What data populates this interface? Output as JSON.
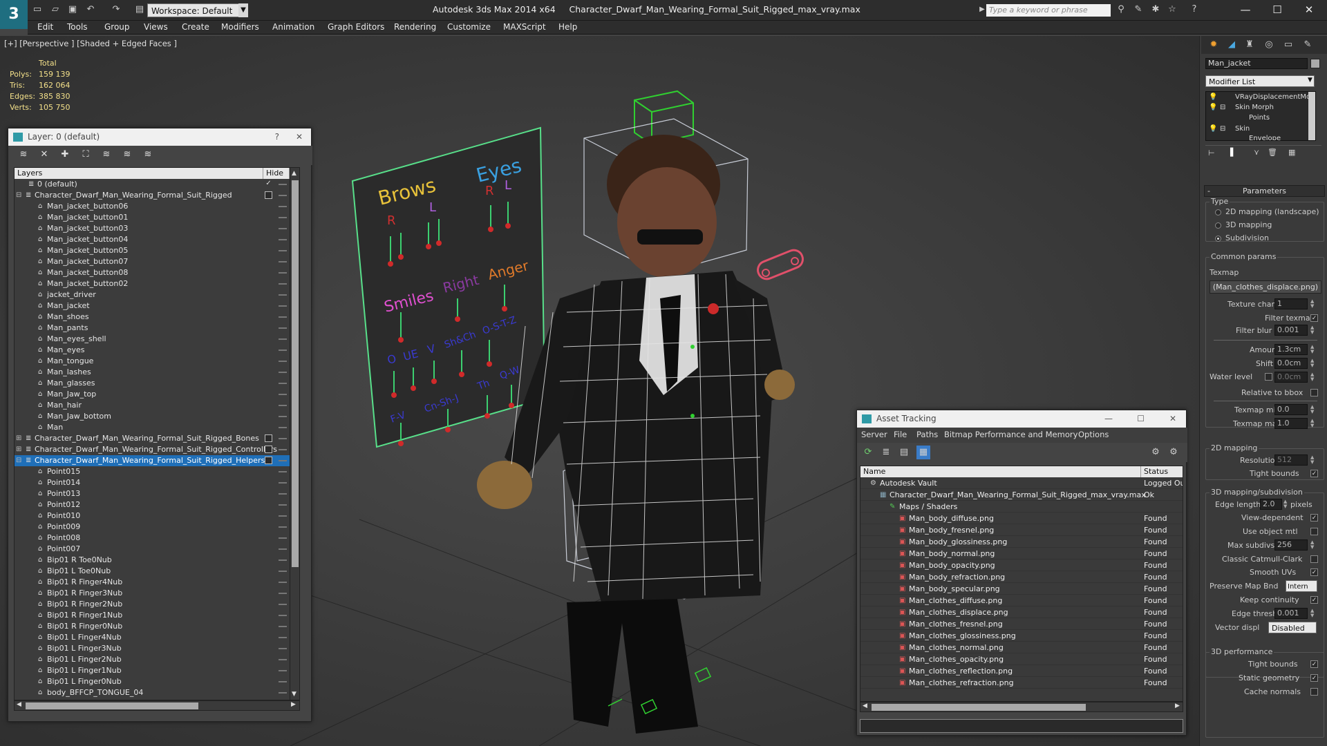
{
  "app": {
    "title": "Autodesk 3ds Max  2014 x64",
    "filename": "Character_Dwarf_Man_Wearing_Formal_Suit_Rigged_max_vray.max",
    "workspace": "Workspace: Default",
    "search_placeholder": "Type a keyword or phrase"
  },
  "menu": [
    "Edit",
    "Tools",
    "Group",
    "Views",
    "Create",
    "Modifiers",
    "Animation",
    "Graph Editors",
    "Rendering",
    "Customize",
    "MAXScript",
    "Help"
  ],
  "viewport": {
    "label": "[+] [Perspective ] [Shaded + Edged Faces ]",
    "stats_header": "Total",
    "stats": [
      {
        "k": "Polys:",
        "v": "159 139"
      },
      {
        "k": "Tris:",
        "v": "162 064"
      },
      {
        "k": "Edges:",
        "v": "385 830"
      },
      {
        "k": "Verts:",
        "v": "105 750"
      }
    ],
    "board_labels": [
      "Brows",
      "Eyes",
      "L",
      "R",
      "R",
      "L",
      "Smiles",
      "Right",
      "Anger",
      "O",
      "UE",
      "V",
      "Sh&Ch",
      "O-S-T-Z",
      "F-V",
      "Cn-Sh-J",
      "Th",
      "Q-W"
    ]
  },
  "layer_dialog": {
    "title": "Layer: 0 (default)",
    "help": "?",
    "close": "✕",
    "col_layers": "Layers",
    "col_hide": "Hide",
    "rows": [
      {
        "label": "0 (default)",
        "indent": 1,
        "type": "layer",
        "mark": "check"
      },
      {
        "label": "Character_Dwarf_Man_Wearing_Formal_Suit_Rigged",
        "indent": 0,
        "type": "layer",
        "expand": "⊟",
        "mark": "box"
      },
      {
        "label": "Man_jacket_button06",
        "indent": 2,
        "type": "obj"
      },
      {
        "label": "Man_jacket_button01",
        "indent": 2,
        "type": "obj"
      },
      {
        "label": "Man_jacket_button03",
        "indent": 2,
        "type": "obj"
      },
      {
        "label": "Man_jacket_button04",
        "indent": 2,
        "type": "obj"
      },
      {
        "label": "Man_jacket_button05",
        "indent": 2,
        "type": "obj"
      },
      {
        "label": "Man_jacket_button07",
        "indent": 2,
        "type": "obj"
      },
      {
        "label": "Man_jacket_button08",
        "indent": 2,
        "type": "obj"
      },
      {
        "label": "Man_jacket_button02",
        "indent": 2,
        "type": "obj"
      },
      {
        "label": "jacket_driver",
        "indent": 2,
        "type": "obj"
      },
      {
        "label": "Man_jacket",
        "indent": 2,
        "type": "obj"
      },
      {
        "label": "Man_shoes",
        "indent": 2,
        "type": "obj"
      },
      {
        "label": "Man_pants",
        "indent": 2,
        "type": "obj"
      },
      {
        "label": "Man_eyes_shell",
        "indent": 2,
        "type": "obj"
      },
      {
        "label": "Man_eyes",
        "indent": 2,
        "type": "obj"
      },
      {
        "label": "Man_tongue",
        "indent": 2,
        "type": "obj"
      },
      {
        "label": "Man_lashes",
        "indent": 2,
        "type": "obj"
      },
      {
        "label": "Man_glasses",
        "indent": 2,
        "type": "obj"
      },
      {
        "label": "Man_Jaw_top",
        "indent": 2,
        "type": "obj"
      },
      {
        "label": "Man_hair",
        "indent": 2,
        "type": "obj"
      },
      {
        "label": "Man_Jaw_bottom",
        "indent": 2,
        "type": "obj"
      },
      {
        "label": "Man",
        "indent": 2,
        "type": "obj"
      },
      {
        "label": "Character_Dwarf_Man_Wearing_Formal_Suit_Rigged_Bones",
        "indent": 0,
        "type": "layer",
        "expand": "⊞",
        "mark": "box"
      },
      {
        "label": "Character_Dwarf_Man_Wearing_Formal_Suit_Rigged_Controllers",
        "indent": 0,
        "type": "layer",
        "expand": "⊞",
        "mark": "box"
      },
      {
        "label": "Character_Dwarf_Man_Wearing_Formal_Suit_Rigged_Helpers",
        "indent": 0,
        "type": "layer",
        "expand": "⊟",
        "mark": "box",
        "selected": true
      },
      {
        "label": "Point015",
        "indent": 2,
        "type": "obj"
      },
      {
        "label": "Point014",
        "indent": 2,
        "type": "obj"
      },
      {
        "label": "Point013",
        "indent": 2,
        "type": "obj"
      },
      {
        "label": "Point012",
        "indent": 2,
        "type": "obj"
      },
      {
        "label": "Point010",
        "indent": 2,
        "type": "obj"
      },
      {
        "label": "Point009",
        "indent": 2,
        "type": "obj"
      },
      {
        "label": "Point008",
        "indent": 2,
        "type": "obj"
      },
      {
        "label": "Point007",
        "indent": 2,
        "type": "obj"
      },
      {
        "label": "Bip01 R Toe0Nub",
        "indent": 2,
        "type": "obj"
      },
      {
        "label": "Bip01 L Toe0Nub",
        "indent": 2,
        "type": "obj"
      },
      {
        "label": "Bip01 R Finger4Nub",
        "indent": 2,
        "type": "obj"
      },
      {
        "label": "Bip01 R Finger3Nub",
        "indent": 2,
        "type": "obj"
      },
      {
        "label": "Bip01 R Finger2Nub",
        "indent": 2,
        "type": "obj"
      },
      {
        "label": "Bip01 R Finger1Nub",
        "indent": 2,
        "type": "obj"
      },
      {
        "label": "Bip01 R Finger0Nub",
        "indent": 2,
        "type": "obj"
      },
      {
        "label": "Bip01 L Finger4Nub",
        "indent": 2,
        "type": "obj"
      },
      {
        "label": "Bip01 L Finger3Nub",
        "indent": 2,
        "type": "obj"
      },
      {
        "label": "Bip01 L Finger2Nub",
        "indent": 2,
        "type": "obj"
      },
      {
        "label": "Bip01 L Finger1Nub",
        "indent": 2,
        "type": "obj"
      },
      {
        "label": "Bip01 L Finger0Nub",
        "indent": 2,
        "type": "obj"
      },
      {
        "label": "body_BFFCP_TONGUE_04",
        "indent": 2,
        "type": "obj"
      }
    ]
  },
  "asset_dialog": {
    "title": "Asset Tracking",
    "menu": [
      "Server",
      "File",
      "Paths",
      "Bitmap Performance and Memory",
      "Options"
    ],
    "col_name": "Name",
    "col_status": "Status",
    "rows": [
      {
        "name": "Autodesk Vault",
        "status": "Logged Ou",
        "indent": 0,
        "icon": "vault"
      },
      {
        "name": "Character_Dwarf_Man_Wearing_Formal_Suit_Rigged_max_vray.max",
        "status": "Ok",
        "indent": 1,
        "icon": "scene"
      },
      {
        "name": "Maps / Shaders",
        "status": "",
        "indent": 2,
        "icon": "maps"
      },
      {
        "name": "Man_body_diffuse.png",
        "status": "Found",
        "indent": 3,
        "icon": "png"
      },
      {
        "name": "Man_body_fresnel.png",
        "status": "Found",
        "indent": 3,
        "icon": "png"
      },
      {
        "name": "Man_body_glossiness.png",
        "status": "Found",
        "indent": 3,
        "icon": "png"
      },
      {
        "name": "Man_body_normal.png",
        "status": "Found",
        "indent": 3,
        "icon": "png"
      },
      {
        "name": "Man_body_opacity.png",
        "status": "Found",
        "indent": 3,
        "icon": "png"
      },
      {
        "name": "Man_body_refraction.png",
        "status": "Found",
        "indent": 3,
        "icon": "png"
      },
      {
        "name": "Man_body_specular.png",
        "status": "Found",
        "indent": 3,
        "icon": "png"
      },
      {
        "name": "Man_clothes_diffuse.png",
        "status": "Found",
        "indent": 3,
        "icon": "png"
      },
      {
        "name": "Man_clothes_displace.png",
        "status": "Found",
        "indent": 3,
        "icon": "png"
      },
      {
        "name": "Man_clothes_fresnel.png",
        "status": "Found",
        "indent": 3,
        "icon": "png"
      },
      {
        "name": "Man_clothes_glossiness.png",
        "status": "Found",
        "indent": 3,
        "icon": "png"
      },
      {
        "name": "Man_clothes_normal.png",
        "status": "Found",
        "indent": 3,
        "icon": "png"
      },
      {
        "name": "Man_clothes_opacity.png",
        "status": "Found",
        "indent": 3,
        "icon": "png"
      },
      {
        "name": "Man_clothes_reflection.png",
        "status": "Found",
        "indent": 3,
        "icon": "png"
      },
      {
        "name": "Man_clothes_refraction.png",
        "status": "Found",
        "indent": 3,
        "icon": "png"
      }
    ]
  },
  "command_panel": {
    "object_name": "Man_jacket",
    "modifier_list": "Modifier List",
    "stack": [
      "VRayDisplacementMod",
      "Skin Morph",
      "Points",
      "Skin",
      "Envelope"
    ],
    "rollout_parameters": "Parameters",
    "type_label": "Type",
    "type_options": [
      "2D mapping (landscape)",
      "3D mapping",
      "Subdivision"
    ],
    "type_selected": 2,
    "common_params": "Common params",
    "texmap_label": "Texmap",
    "texmap_value": "(Man_clothes_displace.png)",
    "texture_chan_label": "Texture chan",
    "texture_chan_value": "1",
    "filter_texmap_label": "Filter texmap",
    "filter_blur_label": "Filter blur",
    "filter_blur_value": "0.001",
    "amount_label": "Amount",
    "amount_value": "1.3cm",
    "shift_label": "Shift",
    "shift_value": "0.0cm",
    "water_level_label": "Water level",
    "water_level_value": "0.0cm",
    "relative_bbox_label": "Relative to bbox",
    "texmap_min_label": "Texmap min",
    "texmap_min_value": "0.0",
    "texmap_max_label": "Texmap max",
    "texmap_max_value": "1.0",
    "mapping2d_label": "2D mapping",
    "resolution_label": "Resolution",
    "resolution_value": "512",
    "tight_bounds_label": "Tight bounds",
    "mapping3d_label": "3D mapping/subdivision",
    "edge_length_label": "Edge length",
    "edge_length_value": "2.0",
    "pixels_label": "pixels",
    "view_dependent_label": "View-dependent",
    "use_object_mtl_label": "Use object mtl",
    "max_subdivs_label": "Max subdivs",
    "max_subdivs_value": "256",
    "classic_catmull_label": "Classic Catmull-Clark",
    "smooth_uvs_label": "Smooth UVs",
    "preserve_map_label": "Preserve Map Bnd",
    "preserve_map_value": "Intern",
    "keep_continuity_label": "Keep continuity",
    "edge_thresh_label": "Edge thresh",
    "edge_thresh_value": "0.001",
    "vector_displ_label": "Vector displ",
    "vector_displ_value": "Disabled",
    "perf_label": "3D performance",
    "tight_bounds2_label": "Tight bounds",
    "static_geometry_label": "Static geometry",
    "cache_normals_label": "Cache normals"
  }
}
